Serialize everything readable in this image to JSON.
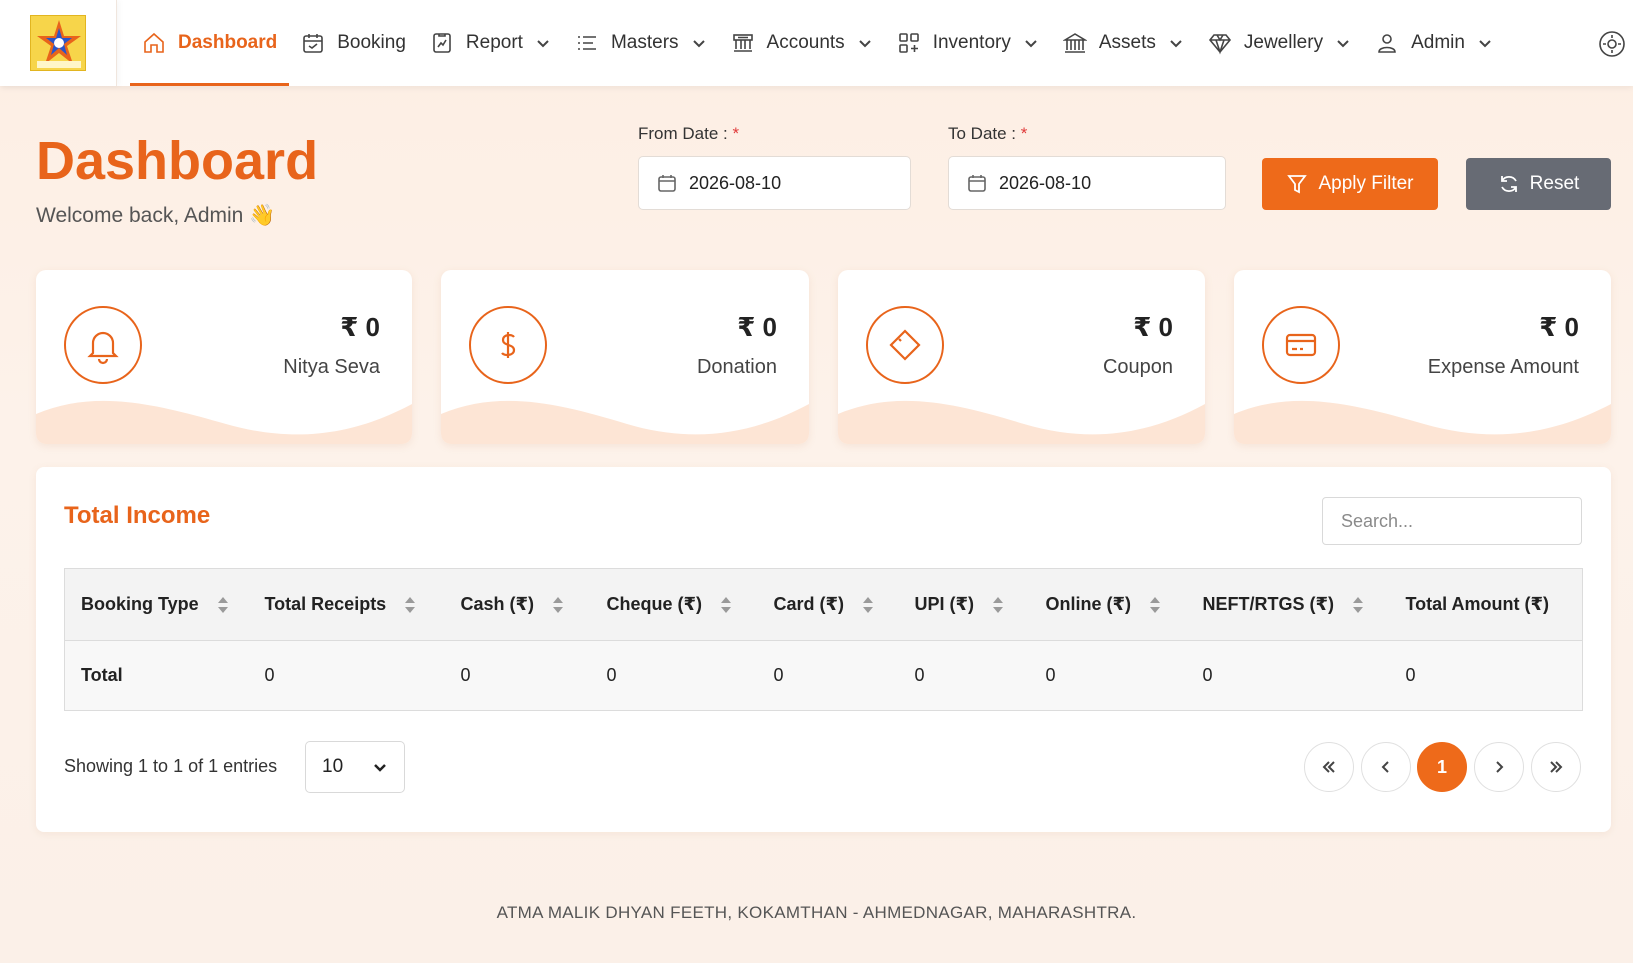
{
  "nav": {
    "logo_text": "श्री आत्मा मलिक",
    "items": [
      {
        "label": "Dashboard",
        "icon": "home-icon",
        "active": true
      },
      {
        "label": "Booking",
        "icon": "calendar-icon"
      },
      {
        "label": "Report",
        "icon": "report-icon",
        "dropdown": true
      },
      {
        "label": "Masters",
        "icon": "list-icon",
        "dropdown": true
      },
      {
        "label": "Accounts",
        "icon": "bank-icon",
        "dropdown": true
      },
      {
        "label": "Inventory",
        "icon": "grid-icon",
        "dropdown": true
      },
      {
        "label": "Assets",
        "icon": "building-icon",
        "dropdown": true
      },
      {
        "label": "Jewellery",
        "icon": "diamond-icon",
        "dropdown": true
      },
      {
        "label": "Admin",
        "icon": "user-icon",
        "dropdown": true
      }
    ],
    "extra_icon": "settings-icon"
  },
  "header": {
    "title": "Dashboard",
    "welcome": "Welcome back, Admin 👋"
  },
  "filters": {
    "from_label": "From Date :",
    "to_label": "To Date :",
    "required_mark": "*",
    "from_value": "2026-08-10",
    "to_value": "2026-08-10",
    "apply_label": "Apply Filter",
    "reset_label": "Reset"
  },
  "cards": [
    {
      "amount": "₹ 0",
      "label": "Nitya Seva",
      "icon": "bell-icon"
    },
    {
      "amount": "₹ 0",
      "label": "Donation",
      "icon": "dollar-icon"
    },
    {
      "amount": "₹ 0",
      "label": "Coupon",
      "icon": "tag-icon"
    },
    {
      "amount": "₹ 0",
      "label": "Expense Amount",
      "icon": "card-icon"
    }
  ],
  "income": {
    "title": "Total Income",
    "search_placeholder": "Search...",
    "columns": [
      "Booking Type",
      "Total Receipts",
      "Cash (₹)",
      "Cheque (₹)",
      "Card (₹)",
      "UPI (₹)",
      "Online (₹)",
      "NEFT/RTGS (₹)",
      "Total Amount (₹)"
    ],
    "rows": [
      [
        "Total",
        "0",
        "0",
        "0",
        "0",
        "0",
        "0",
        "0",
        "0"
      ]
    ],
    "showing": "Showing 1 to 1 of 1 entries",
    "page_size": "10",
    "current_page": "1"
  },
  "footer": "ATMA MALIK DHYAN FEETH, KOKAMTHAN - AHMEDNAGAR, MAHARASHTRA.",
  "colors": {
    "accent": "#e8641b",
    "reset": "#676b74"
  }
}
